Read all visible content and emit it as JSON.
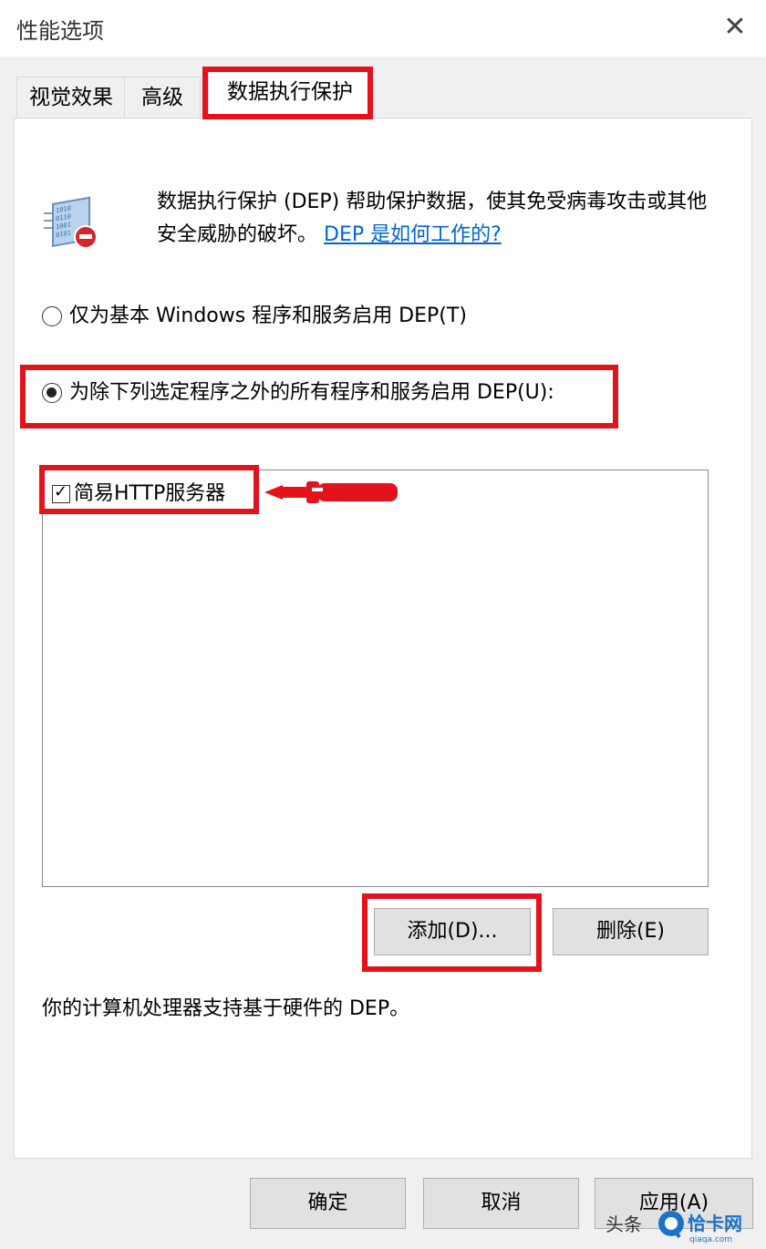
{
  "window": {
    "title": "性能选项",
    "close_glyph": "✕"
  },
  "tabs": [
    {
      "label": "视觉效果",
      "selected": false
    },
    {
      "label": "高级",
      "selected": false
    },
    {
      "label": "数据执行保护",
      "selected": true
    }
  ],
  "dep": {
    "description": "数据执行保护 (DEP) 帮助保护数据，使其免受病毒攻击或其他安全威胁的破坏。",
    "help_link": "DEP 是如何工作的?",
    "icon": "dep-shield-stop-icon"
  },
  "options": {
    "basic_only": {
      "label": "仅为基本 Windows 程序和服务启用 DEP(T)",
      "selected": false
    },
    "all_except": {
      "label": "为除下列选定程序之外的所有程序和服务启用 DEP(U):",
      "selected": true
    }
  },
  "exception_list": [
    {
      "label": "简易HTTP服务器",
      "checked": true
    }
  ],
  "list_buttons": {
    "add": "添加(D)...",
    "remove": "删除(E)"
  },
  "hardware_status": "你的计算机处理器支持基于硬件的 DEP。",
  "footer_buttons": {
    "ok": "确定",
    "cancel": "取消",
    "apply": "应用(A)"
  },
  "watermark": {
    "source": "头条",
    "site": "恰卡网",
    "site_url_text": "qiaqa.com"
  },
  "colors": {
    "highlight": "#e3121b",
    "link": "#0066cc"
  }
}
